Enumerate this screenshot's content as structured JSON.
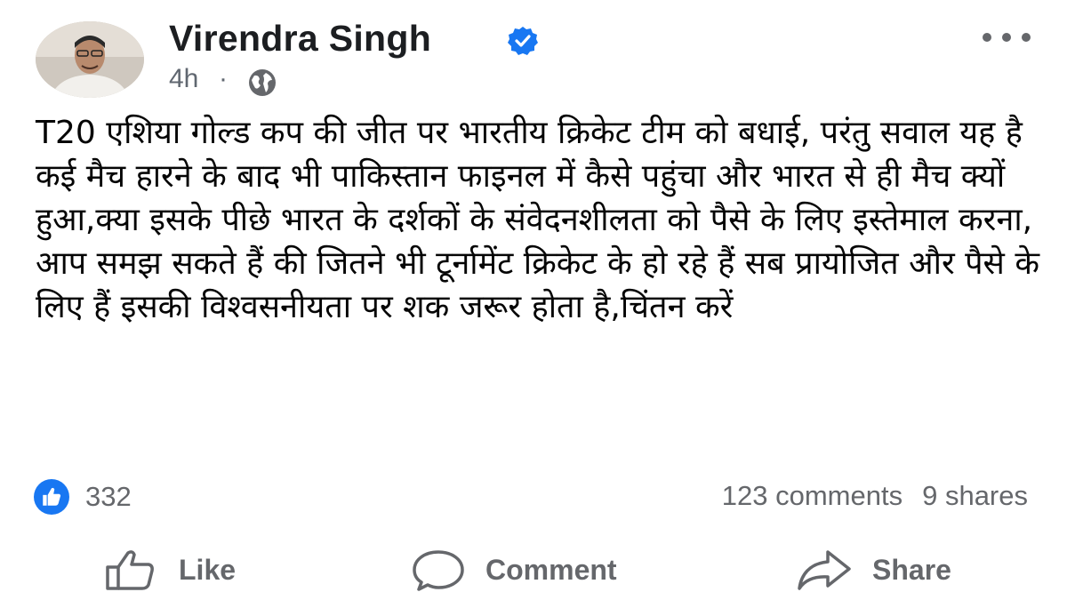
{
  "post": {
    "author": {
      "name": "Virendra Singh",
      "verified": true,
      "avatar_icon": "profile-photo"
    },
    "time": "4h",
    "separator": "·",
    "audience_icon": "globe-icon",
    "text": "T20 एशिया गोल्ड कप की जीत पर भारतीय क्रिकेट टीम को बधाई, परंतु सवाल यह है कई मैच हारने के बाद भी पाकिस्तान फाइनल में कैसे पहुंचा और भारत से ही मैच क्यों हुआ,क्या इसके पीछे भारत के दर्शकों के संवेदनशीलता को पैसे के लिए इस्तेमाल करना, आप समझ सकते हैं की जितने भी टूर्नामेंट क्रिकेट के हो रहे हैं सब प्रायोजित और पैसे के लिए हैं इसकी विश्वसनीयता पर शक जरूर होता है,चिंतन करें",
    "reactions": {
      "count": "332",
      "icon": "like-reaction-icon"
    },
    "comments_label": "123 comments",
    "shares_label": "9 shares"
  },
  "actions": {
    "like_label": "Like",
    "comment_label": "Comment",
    "share_label": "Share"
  },
  "colors": {
    "brand_blue": "#1877f2",
    "muted_text": "#65676b",
    "body_text": "#050505"
  }
}
